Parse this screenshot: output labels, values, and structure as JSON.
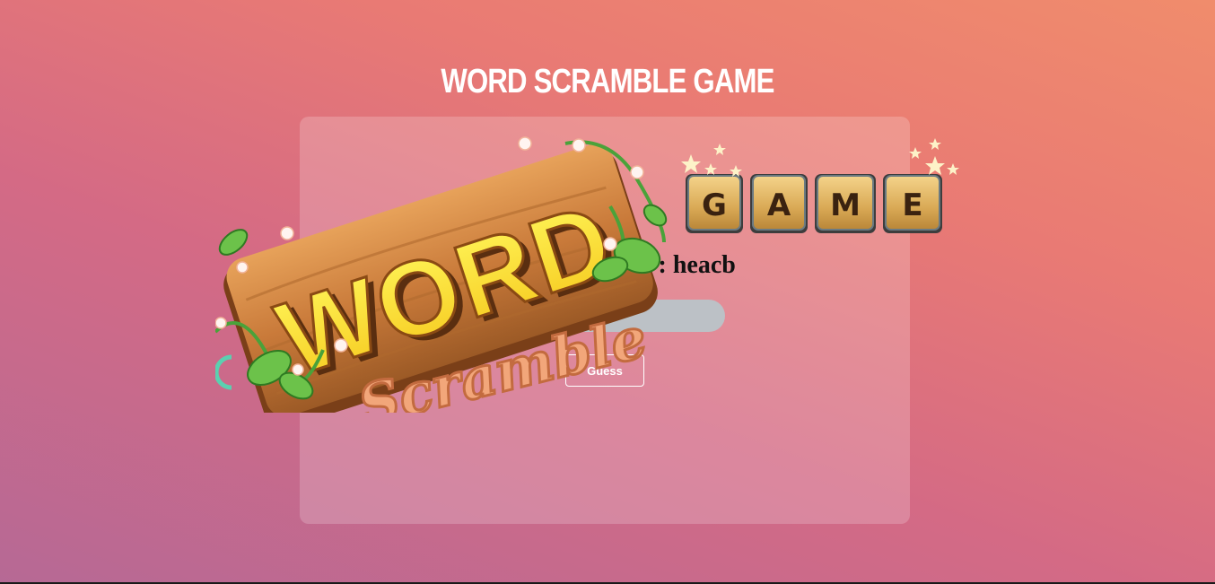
{
  "header": {
    "title": "WORD SCRAMBLE GAME"
  },
  "game": {
    "scrambled_text": "Scrambled word : heacb",
    "input_placeholder": "",
    "guess_button_label": "Guess"
  },
  "logo": {
    "word_text": "WORD",
    "scramble_text": "Scramble",
    "game_tiles": [
      "G",
      "A",
      "M",
      "E"
    ]
  },
  "colors": {
    "background_start": "#f08c6c",
    "background_end": "#b66995",
    "input_bg": "#bcc1c6",
    "title": "#ffffff"
  }
}
